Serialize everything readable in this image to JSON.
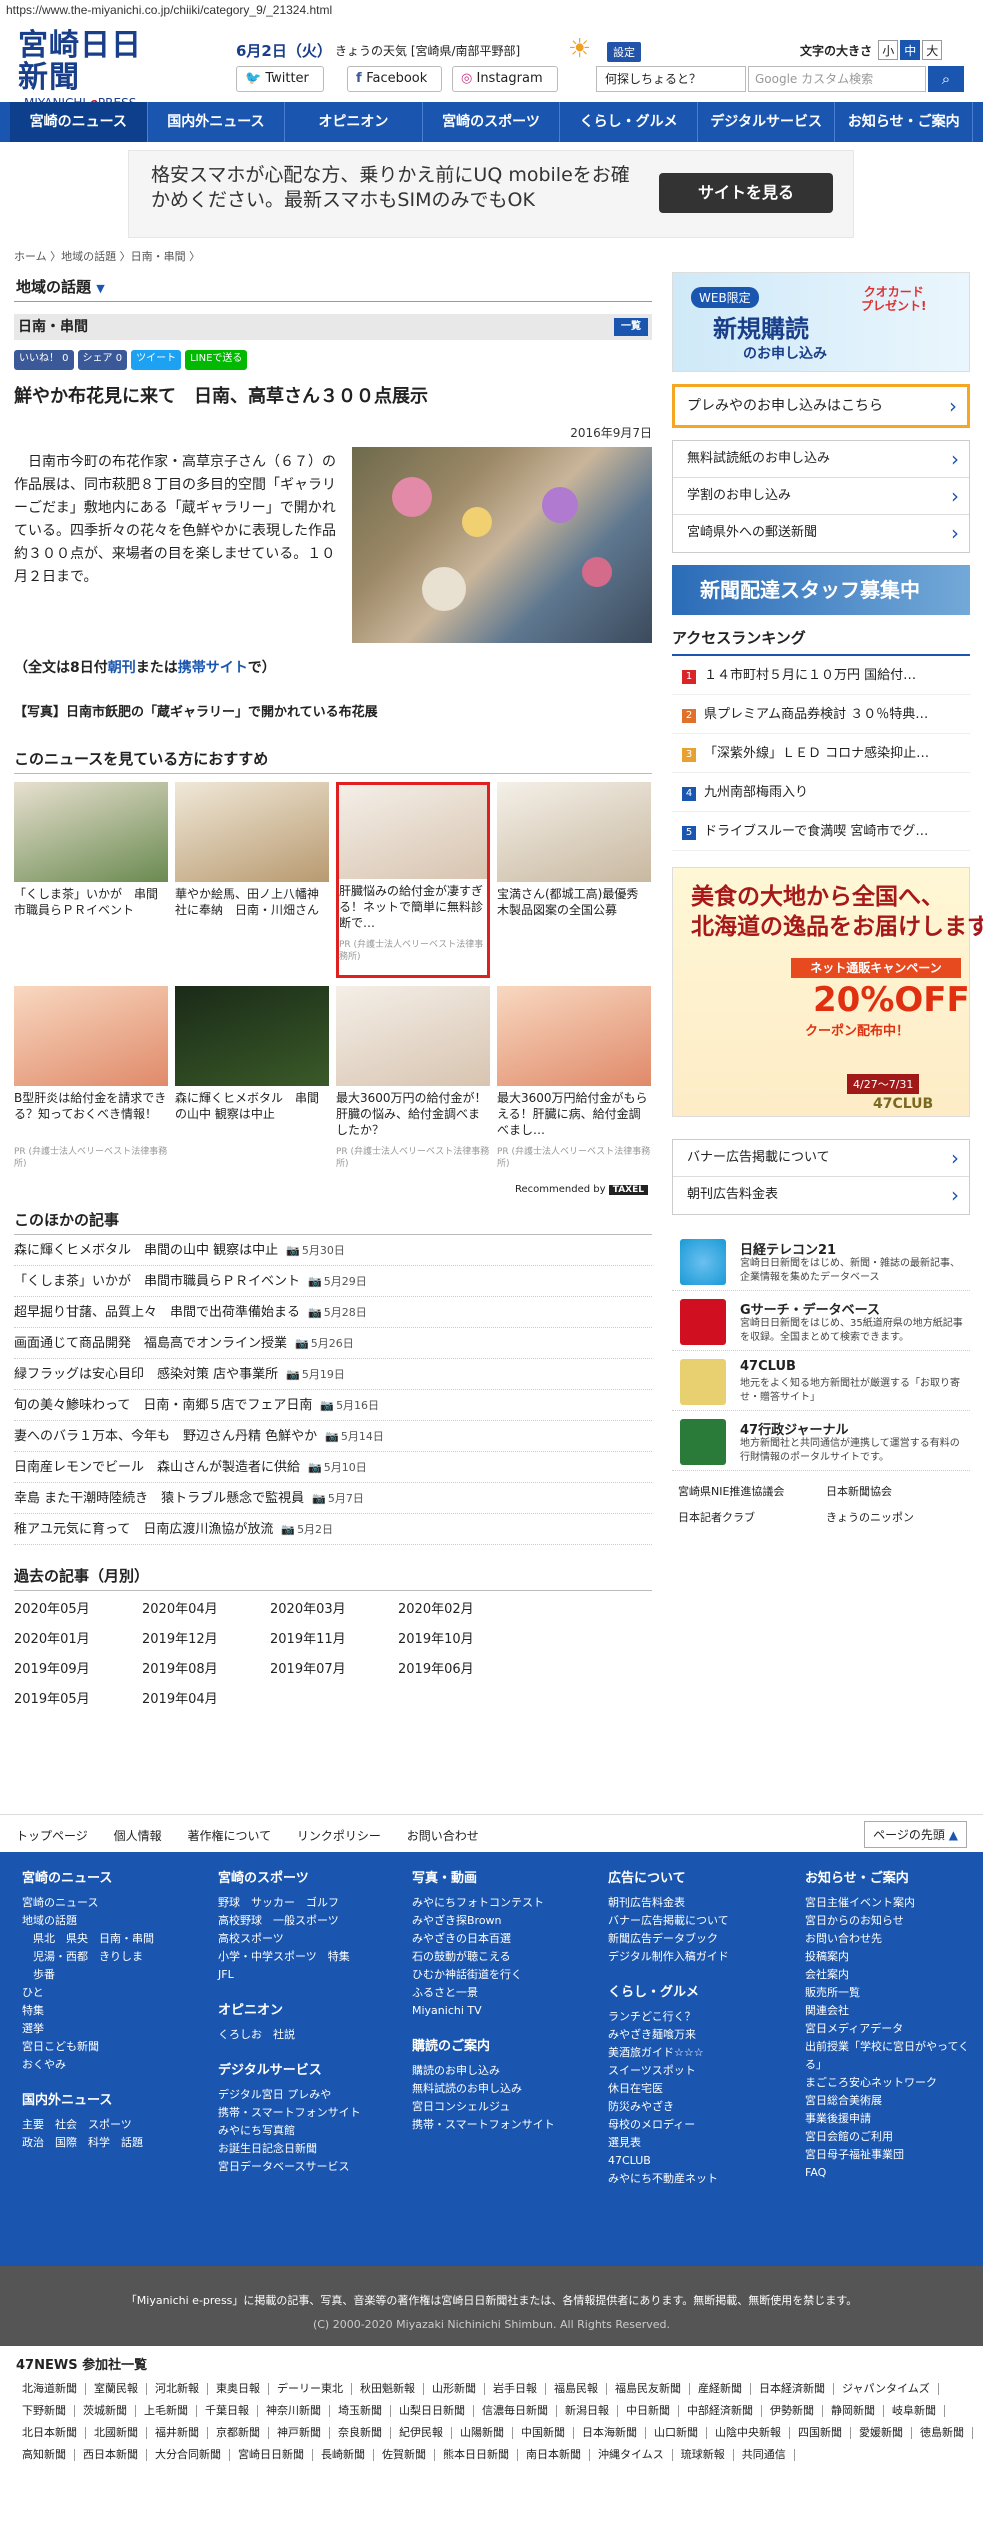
{
  "url": "https://www.the-miyanichi.co.jp/chiiki/category_9/_21324.html",
  "header": {
    "logo_main": "宮崎日日新聞",
    "logo_sub_a": "MIYANICHI ",
    "logo_sub_b": "e",
    "logo_sub_c": "PRESS",
    "date": "6月2日（火）",
    "weather": "きょうの天気 [宮崎県/南部平野部]",
    "settings": "設定",
    "font_size_label": "文字の大きさ",
    "font_sizes": [
      "小",
      "中",
      "大"
    ],
    "twitter": "Twitter",
    "facebook": "Facebook",
    "instagram": "Instagram",
    "hint": "何探しちょると？",
    "search_placeholder": "Google カスタム検索"
  },
  "nav": [
    "宮崎のニュース",
    "国内外ニュース",
    "オピニオン",
    "宮崎のスポーツ",
    "くらし・グルメ",
    "デジタルサービス",
    "お知らせ・ご案内"
  ],
  "ad": {
    "text": "格安スマホが心配な方、乗りかえ前にUQ mobileをお確かめください。最新スマホもSIMのみでもOK",
    "button": "サイトを見る"
  },
  "breadcrumb": "ホーム 〉地域の話題 〉日南・串間 〉",
  "section": "地域の話題",
  "category": "日南・串間",
  "category_link": "一覧",
  "share": [
    "いいね！ 0",
    "シェア 0",
    "ツイート",
    "LINEで送る"
  ],
  "article": {
    "title": "鮮やか布花見に来て　日南、高草さん３００点展示",
    "date": "2016年9月7日",
    "body": "日南市今町の布花作家・高草京子さん（６７）の作品展は、同市萩肥８丁目の多目的空間「ギャラリーごだま」敷地内にある「蔵ギャラリー」で開かれている。四季折々の花々を色鮮やかに表現した作品約３００点が、来場者の目を楽しませている。１０月２日まで。",
    "full_a": "（全文は8日付",
    "full_b": "朝刊",
    "full_c": "または",
    "full_d": "携帯サイト",
    "full_e": "で）",
    "caption": "【写真】日南市飫肥の「蔵ギャラリー」で開かれている布花展"
  },
  "recommend": {
    "heading": "このニュースを見ている方におすすめ",
    "items": [
      {
        "title": "「くしま茶」いかが　串間市職員らＰＲイベント",
        "pr": ""
      },
      {
        "title": "華やか絵馬、田ノ上八幡神社に奉納　日南・川畑さん",
        "pr": ""
      },
      {
        "title": "肝臓悩みの給付金が凄すぎる！ネットで簡単に無料診断で…",
        "pr": "PR (弁護士法人ベリーベスト法律事務所)"
      },
      {
        "title": "宝満さん(都城工高)最優秀　木製品図案の全国公募",
        "pr": ""
      },
      {
        "title": "B型肝炎は給付金を請求できる？知っておくべき情報！",
        "pr": "PR (弁護士法人ベリーベスト法律事務所)"
      },
      {
        "title": "森に輝くヒメボタル　串間の山中 観察は中止",
        "pr": ""
      },
      {
        "title": "最大3600万円の給付金が！肝臓の悩み、給付金調べましたか？",
        "pr": "PR (弁護士法人ベリーベスト法律事務所)"
      },
      {
        "title": "最大3600万円給付金がもらえる！肝臓に病、給付金調べまし…",
        "pr": "PR (弁護士法人ベリーベスト法律事務所)"
      }
    ],
    "by": "Recommended by",
    "by_brand": "TAXEL"
  },
  "other": {
    "heading": "このほかの記事",
    "items": [
      {
        "title": "森に輝くヒメボタル　串間の山中 観察は中止",
        "date": "5月30日"
      },
      {
        "title": "「くしま茶」いかが　串間市職員らＰＲイベント",
        "date": "5月29日"
      },
      {
        "title": "超早掘り甘藷、品質上々　串間で出荷準備始まる",
        "date": "5月28日"
      },
      {
        "title": "画面通じて商品開発　福島高でオンライン授業",
        "date": "5月26日"
      },
      {
        "title": "緑フラッグは安心目印　感染対策 店や事業所",
        "date": "5月19日"
      },
      {
        "title": "旬の美々鯵味わって　日南・南郷５店でフェア日南",
        "date": "5月16日"
      },
      {
        "title": "妻へのバラ１万本、今年も　野辺さん丹精 色鮮やか",
        "date": "5月14日"
      },
      {
        "title": "日南産レモンでビール　森山さんが製造者に供給",
        "date": "5月10日"
      },
      {
        "title": "幸島 また干潮時陸続き　猿トラブル懸念で監視員",
        "date": "5月7日"
      },
      {
        "title": "稚アユ元気に育って　日南広渡川漁協が放流",
        "date": "5月2日"
      }
    ]
  },
  "past": {
    "heading": "過去の記事（月別）",
    "months": [
      "2020年05月",
      "2020年04月",
      "2020年03月",
      "2020年02月",
      "2020年01月",
      "2019年12月",
      "2019年11月",
      "2019年10月",
      "2019年09月",
      "2019年08月",
      "2019年07月",
      "2019年06月",
      "2019年05月",
      "2019年04月"
    ]
  },
  "sidebar": {
    "banner_web": "WEB限定",
    "banner_main": "新規購読",
    "banner_sub": "のお申し込み",
    "banner_quo": "クオカード\nプレゼント!",
    "premia": "プレみやのお申し込みはこちら",
    "links": [
      "無料試読紙のお申し込み",
      "学割のお申し込み",
      "宮崎県外への郵送新聞"
    ],
    "staff": "新聞配達スタッフ募集中",
    "ranking_heading": "アクセスランキング",
    "ranking": [
      {
        "n": "1",
        "t": "１４市町村５月に１０万円 国給付…",
        "c": "#d9242a"
      },
      {
        "n": "2",
        "t": "県プレミアム商品券検討 ３０％特典…",
        "c": "#e0702a"
      },
      {
        "n": "3",
        "t": "「深紫外線」ＬＥＤ コロナ感染抑止…",
        "c": "#e8a030"
      },
      {
        "n": "4",
        "t": "九州南部梅雨入り",
        "c": "#1a56b0"
      },
      {
        "n": "5",
        "t": "ドライブスルーで食満喫 宮崎市でグ…",
        "c": "#1a56b0"
      }
    ],
    "bigad": {
      "title": "美食の大地から全国へ、\n北海道の逸品をお届けします。",
      "campaign": "ネット通販キャンペーン",
      "pct": "20%OFF",
      "coupon": "クーポン配布中！",
      "period": "4/27〜7/31",
      "club": "47CLUB"
    },
    "blinks": [
      "バナー広告掲載について",
      "朝刊広告料金表"
    ],
    "services": [
      {
        "t": "日経テレコン21",
        "d": "宮崎日日新聞をはじめ、新聞・雑誌の最新記事、企業情報を集めたデータベース",
        "c": "#1a9ad6"
      },
      {
        "t": "Gサーチ・データベース",
        "d": "宮崎日日新聞をはじめ、35紙道府県の地方紙記事を収録。全国まとめて検索できます。",
        "c": "#d01020"
      },
      {
        "t": "47CLUB",
        "d": "地元をよく知る地方新聞社が厳選する「お取り寄せ・贈答サイト」",
        "c": "#b8a020"
      },
      {
        "t": "47行政ジャーナル",
        "d": "地方新聞社と共同通信が連携して運営する有料の行財情報のポータルサイトです。",
        "c": "#2a7a3a"
      }
    ],
    "orgs": [
      "宮崎県NIE推進協議会",
      "日本新聞協会",
      "日本記者クラブ",
      "きょうのニッポン"
    ]
  },
  "footer": {
    "links": [
      "トップページ",
      "個人情報",
      "著作権について",
      "リンクポリシー",
      "お問い合わせ"
    ],
    "top": "ページの先頭",
    "cols": [
      {
        "h": "宮崎のニュース",
        "items": [
          "宮崎のニュース",
          "地域の話題",
          "　県北　県央　日南・串間",
          "　児湯・西都　きりしま",
          "　歩番",
          "ひと",
          "特集",
          "選挙",
          "宮日こども新聞",
          "おくやみ"
        ],
        "h2": "国内外ニュース",
        "items2": [
          "主要　社会　スポーツ",
          "政治　国際　科学　話題"
        ]
      },
      {
        "h": "宮崎のスポーツ",
        "items": [
          "野球　サッカー　ゴルフ",
          "高校野球　一般スポーツ",
          "高校スポーツ",
          "小学・中学スポーツ　特集",
          "JFL"
        ],
        "h2": "オピニオン",
        "items2": [
          "くろしお　社説"
        ],
        "h3": "デジタルサービス",
        "items3": [
          "デジタル宮日 プレみや",
          "携帯・スマートフォンサイト",
          "みやにち写真館",
          "お誕生日記念日新聞",
          "宮日データベースサービス"
        ]
      },
      {
        "h": "写真・動画",
        "items": [
          "みやにちフォトコンテスト",
          "みやざき探Brown",
          "みやざきの日本百選",
          "石の鼓動が聴こえる",
          "ひむか神話街道を行く",
          "ふるさと一景",
          "Miyanichi TV"
        ],
        "h2": "購読のご案内",
        "items2": [
          "購読のお申し込み",
          "無料試読のお申し込み",
          "宮日コンシェルジュ",
          "携帯・スマートフォンサイト"
        ]
      },
      {
        "h": "広告について",
        "items": [
          "朝刊広告料金表",
          "バナー広告掲載について",
          "新聞広告データブック",
          "デジタル制作入稿ガイド"
        ],
        "h2": "くらし・グルメ",
        "items2": [
          "ランチどこ行く？",
          "みやざき麺喰万来",
          "美酒旅ガイド☆☆☆",
          "スイーツスポット",
          "休日在宅医",
          "防災みやざき",
          "母校のメロディー",
          "選見表",
          "47CLUB",
          "みやにち不動産ネット"
        ]
      },
      {
        "h": "お知らせ・ご案内",
        "items": [
          "宮日主催イベント案内",
          "宮日からのお知らせ",
          "お問い合わせ先",
          "投稿案内",
          "会社案内",
          "販売所一覧",
          "関連会社",
          "宮日メディアデータ",
          "出前授業「学校に宮日がやってくる」",
          "まごころ安心ネットワーク",
          "宮日総合美術展",
          "事業後援申請",
          "宮日会館のご利用",
          "宮日母子福祉事業団",
          "FAQ"
        ]
      }
    ],
    "notice": "「Miyanichi e-press」に掲載の記事、写真、音楽等の著作権は宮崎日日新聞社または、各情報提供者にあります。無断掲載、無断使用を禁じます。",
    "copyright": "(C) 2000-2020 Miyazaki Nichinichi Shimbun. All Rights Reserved.",
    "news47_heading": "47NEWS 参加社一覧",
    "news47": [
      "北海道新聞",
      "室蘭民報",
      "河北新報",
      "東奥日報",
      "デーリー東北",
      "秋田魁新報",
      "山形新聞",
      "岩手日報",
      "福島民報",
      "福島民友新聞",
      "産経新聞",
      "日本経済新聞",
      "ジャパンタイムズ",
      "下野新聞",
      "茨城新聞",
      "上毛新聞",
      "千葉日報",
      "神奈川新聞",
      "埼玉新聞",
      "山梨日日新聞",
      "信濃毎日新聞",
      "新潟日報",
      "中日新聞",
      "中部経済新聞",
      "伊勢新聞",
      "静岡新聞",
      "岐阜新聞",
      "北日本新聞",
      "北國新聞",
      "福井新聞",
      "京都新聞",
      "神戸新聞",
      "奈良新聞",
      "紀伊民報",
      "山陽新聞",
      "中国新聞",
      "日本海新聞",
      "山口新聞",
      "山陰中央新報",
      "四国新聞",
      "愛媛新聞",
      "徳島新聞",
      "高知新聞",
      "西日本新聞",
      "大分合同新聞",
      "宮崎日日新聞",
      "長崎新聞",
      "佐賀新聞",
      "熊本日日新聞",
      "南日本新聞",
      "沖縄タイムス",
      "琉球新報",
      "共同通信"
    ]
  }
}
